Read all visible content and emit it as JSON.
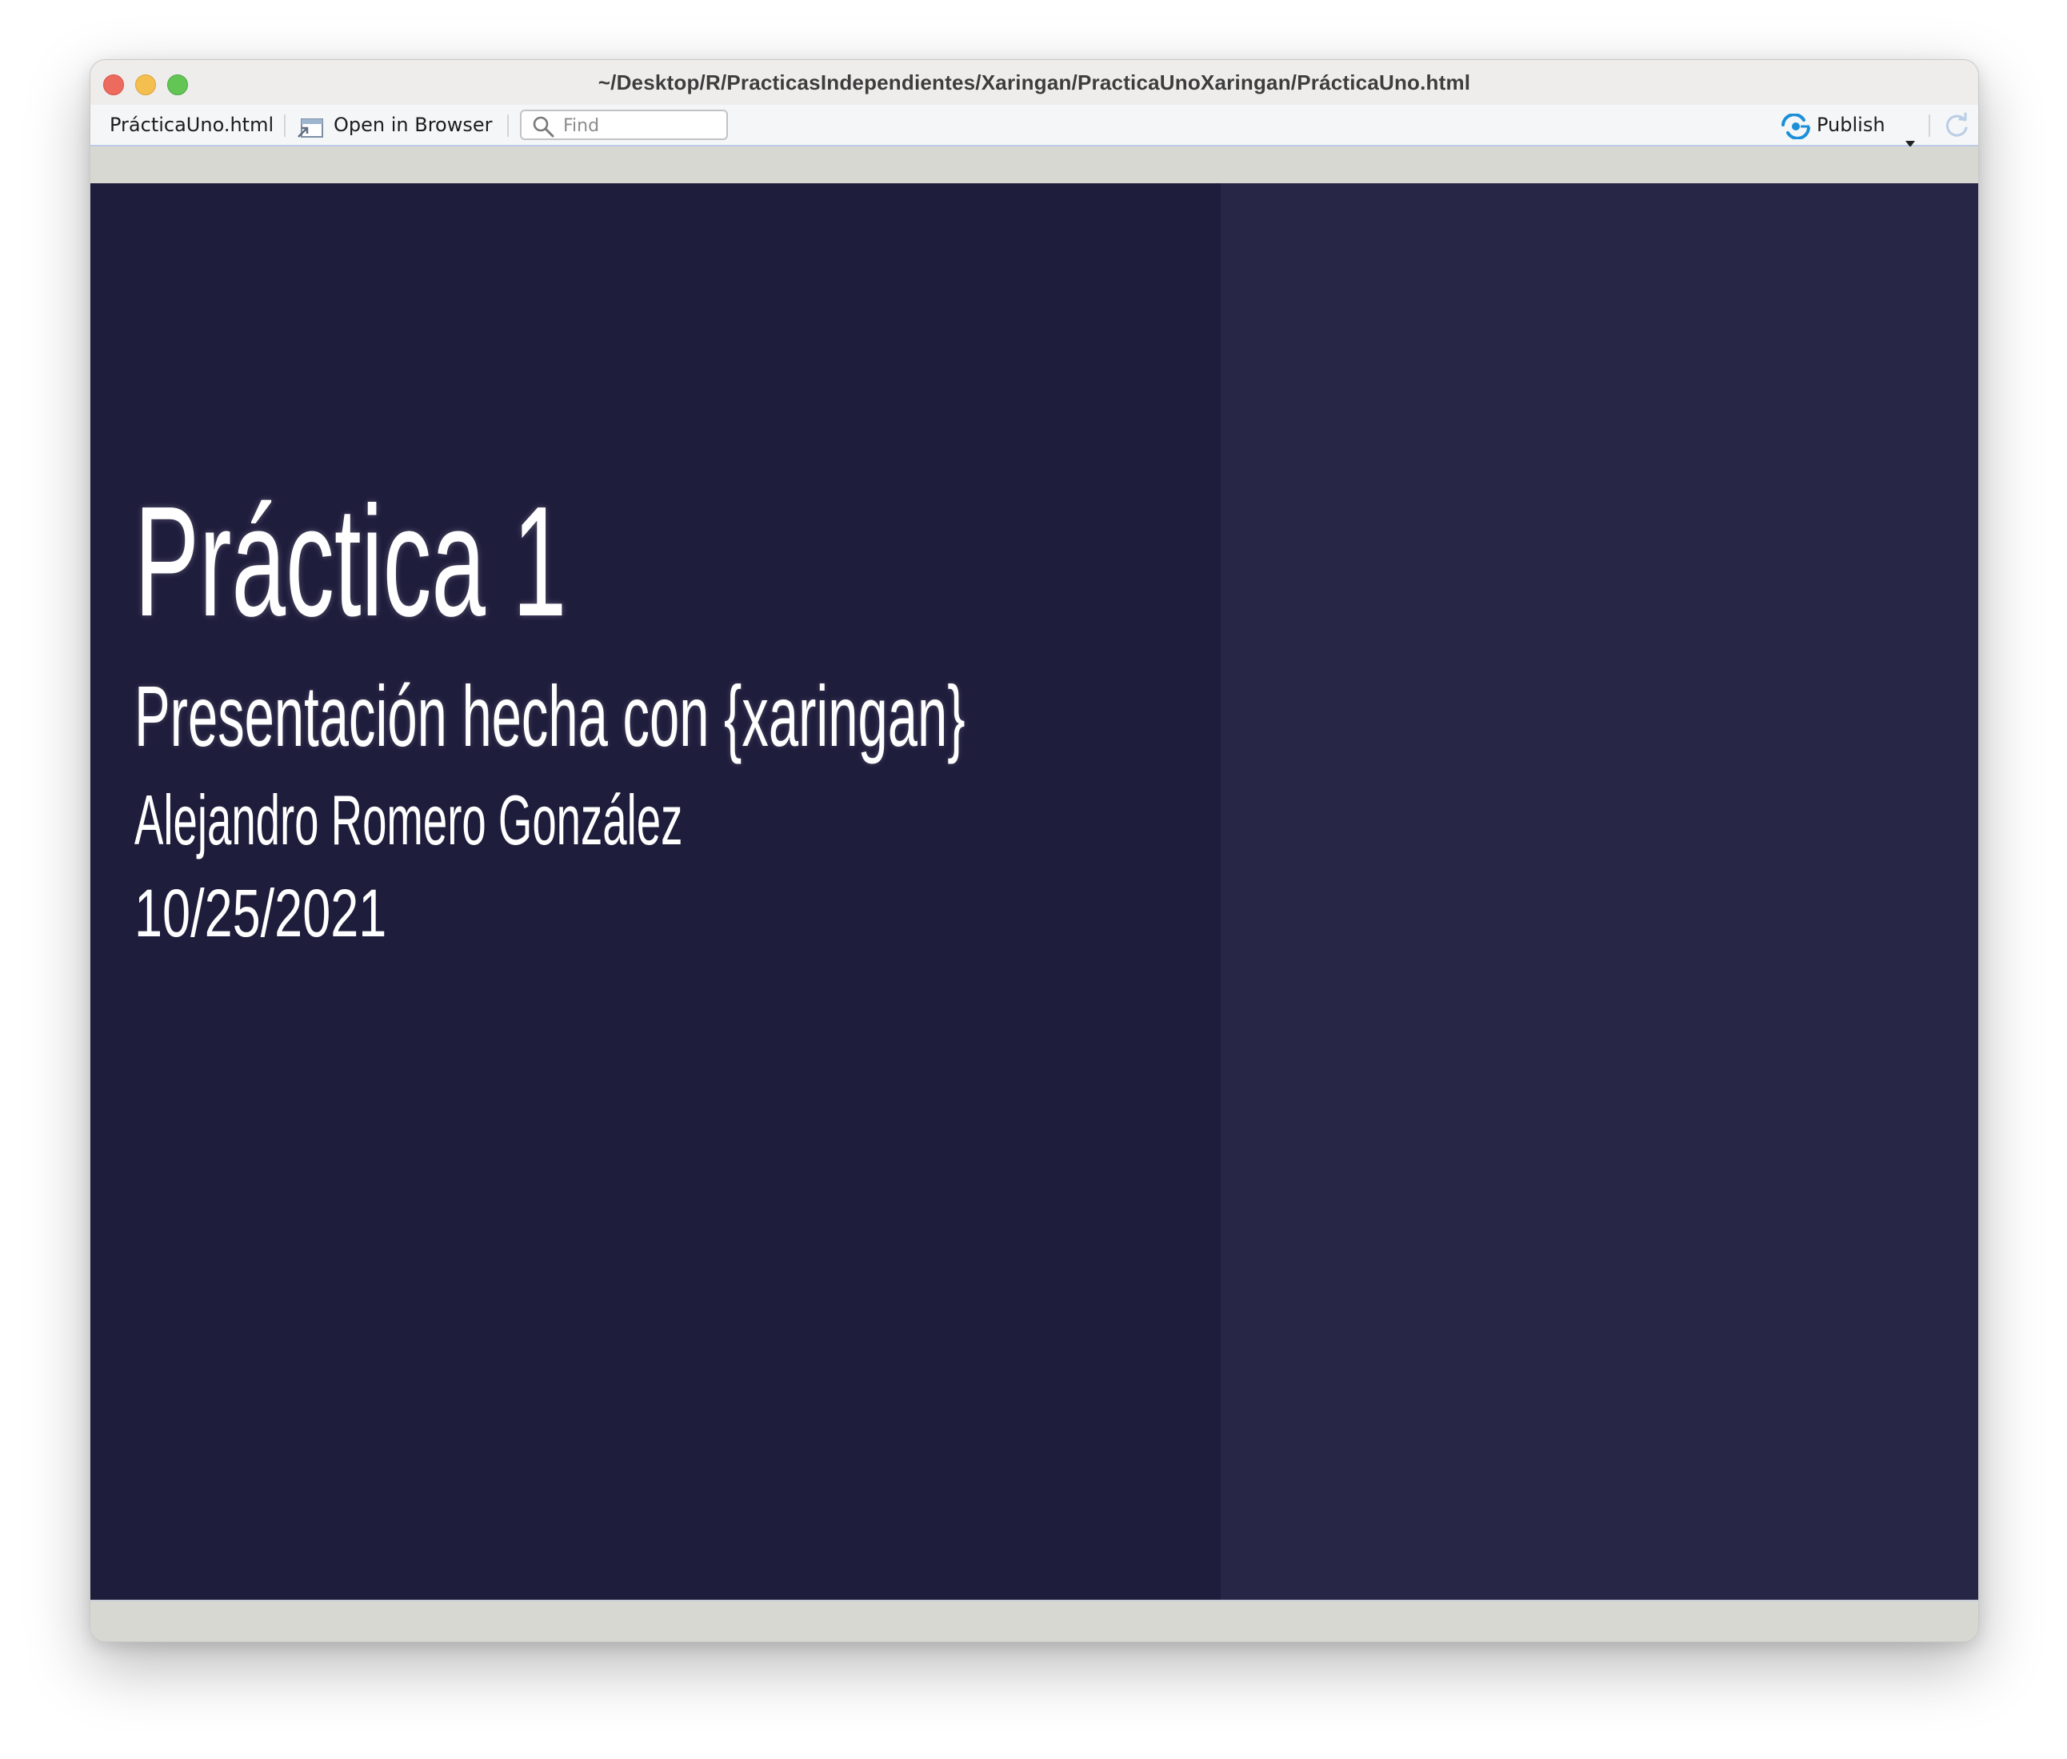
{
  "window": {
    "title": "~/Desktop/R/PracticasIndependientes/Xaringan/PracticaUnoXaringan/PrácticaUno.html"
  },
  "toolbar": {
    "file_label": "PrácticaUno.html",
    "open_browser_label": "Open in Browser",
    "find_placeholder": "Find",
    "publish_label": "Publish",
    "icons": {
      "open_browser": "browser-window-icon",
      "find": "search-icon",
      "publish": "publish-icon",
      "dropdown": "chevron-down-icon",
      "refresh": "refresh-icon"
    }
  },
  "slide": {
    "title": "Práctica 1",
    "subtitle": "Presentación hecha con {xaringan}",
    "author": "Alejandro Romero González",
    "date": "10/25/2021"
  },
  "colors": {
    "slide_background": "#1f1d3c",
    "slide_side_background": "#272647",
    "slide_text": "#ffffff",
    "publish_accent": "#1b8fd8"
  }
}
